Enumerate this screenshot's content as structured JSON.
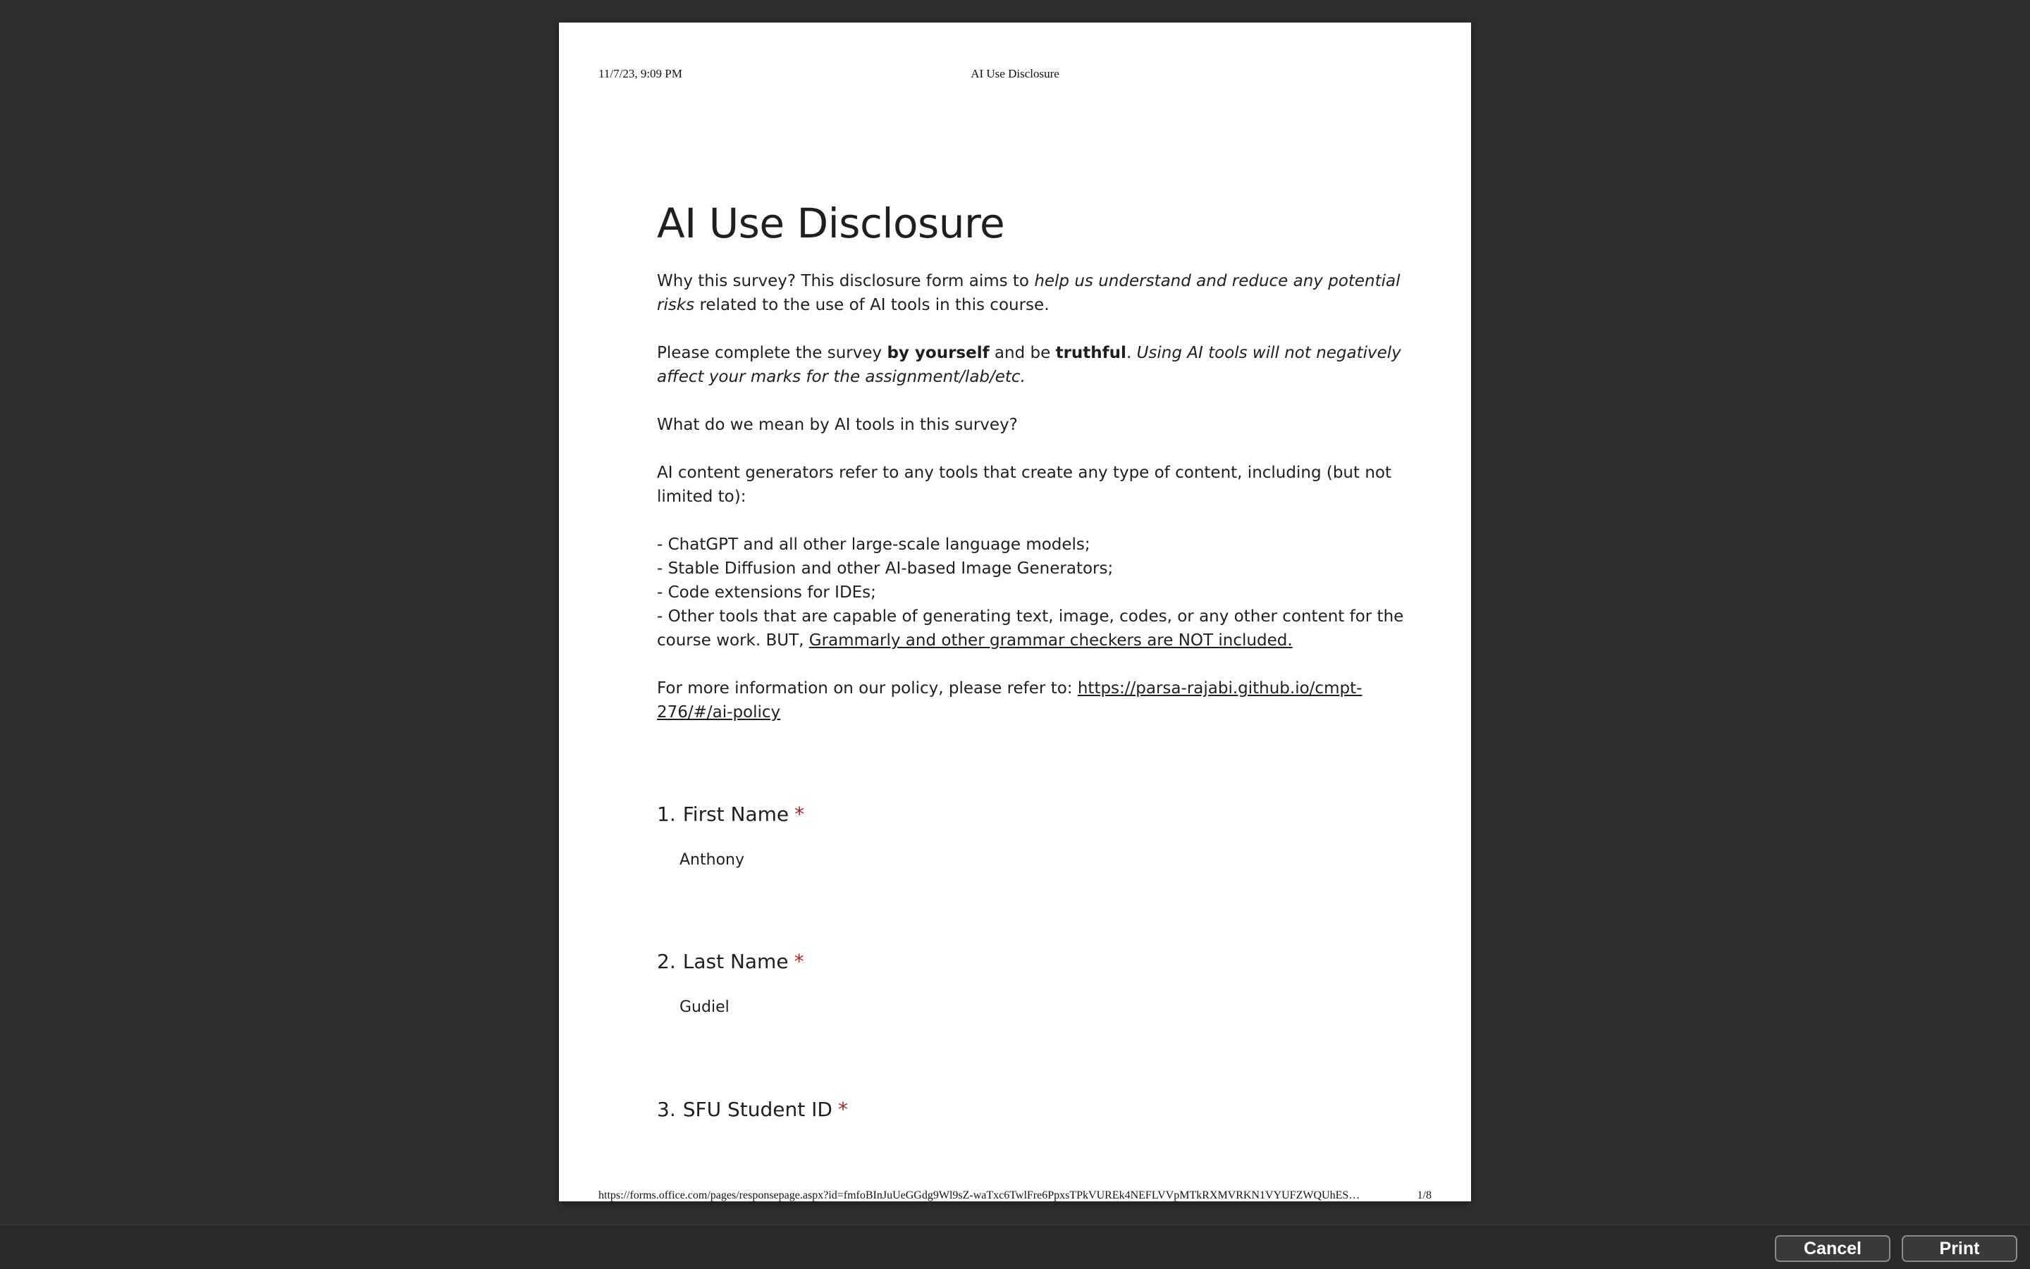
{
  "page": {
    "header_date": "11/7/23, 9:09 PM",
    "header_title": "AI Use Disclosure",
    "footer_url": "https://forms.office.com/pages/responsepage.aspx?id=fmfoBInJuUeGGdg9Wl9sZ-waTxc6TwlFre6PpxsTPkVUREk4NEFLVVpMTkRXMVRKN1VYUFZWQUhES…",
    "page_number": "1/8"
  },
  "form": {
    "title": "AI Use Disclosure",
    "p1": {
      "lead": "Why this survey? This disclosure form aims to ",
      "italic": "help us understand and reduce any potential risks",
      "tail": " related to the use of AI tools in this course."
    },
    "p2": {
      "a": "Please complete the survey ",
      "bold1": "by yourself",
      "b": " and be ",
      "bold2": "truthful",
      "c": ". ",
      "italic": "Using AI tools will not negatively affect your marks for the assignment/lab/etc."
    },
    "p3": "What do we mean by AI tools in this survey?",
    "p4": "AI content generators refer to any tools that create any type of content, including (but not limited to):",
    "list": [
      "- ChatGPT and all other large-scale language models;",
      "- Stable Diffusion and other AI-based Image Generators;",
      "- Code extensions for IDEs;"
    ],
    "list_last": {
      "text": "- Other tools that are capable of generating text, image, codes, or any other content for the course work. BUT, ",
      "underlined": "Grammarly and other grammar checkers are NOT included."
    },
    "policy": {
      "text": "For more information on our policy, please refer to: ",
      "link": "https://parsa-rajabi.github.io/cmpt-276/#/ai-policy"
    },
    "questions": [
      {
        "number": "1.",
        "label": "First Name",
        "required": "*",
        "answer": "Anthony"
      },
      {
        "number": "2.",
        "label": "Last Name",
        "required": "*",
        "answer": "Gudiel"
      },
      {
        "number": "3.",
        "label": "SFU Student ID",
        "required": "*",
        "answer": ""
      }
    ]
  },
  "dialog": {
    "cancel_label": "Cancel",
    "print_label": "Print"
  },
  "colors": {
    "background": "#2f2f2f",
    "page": "#ffffff",
    "required": "#a4262c"
  }
}
